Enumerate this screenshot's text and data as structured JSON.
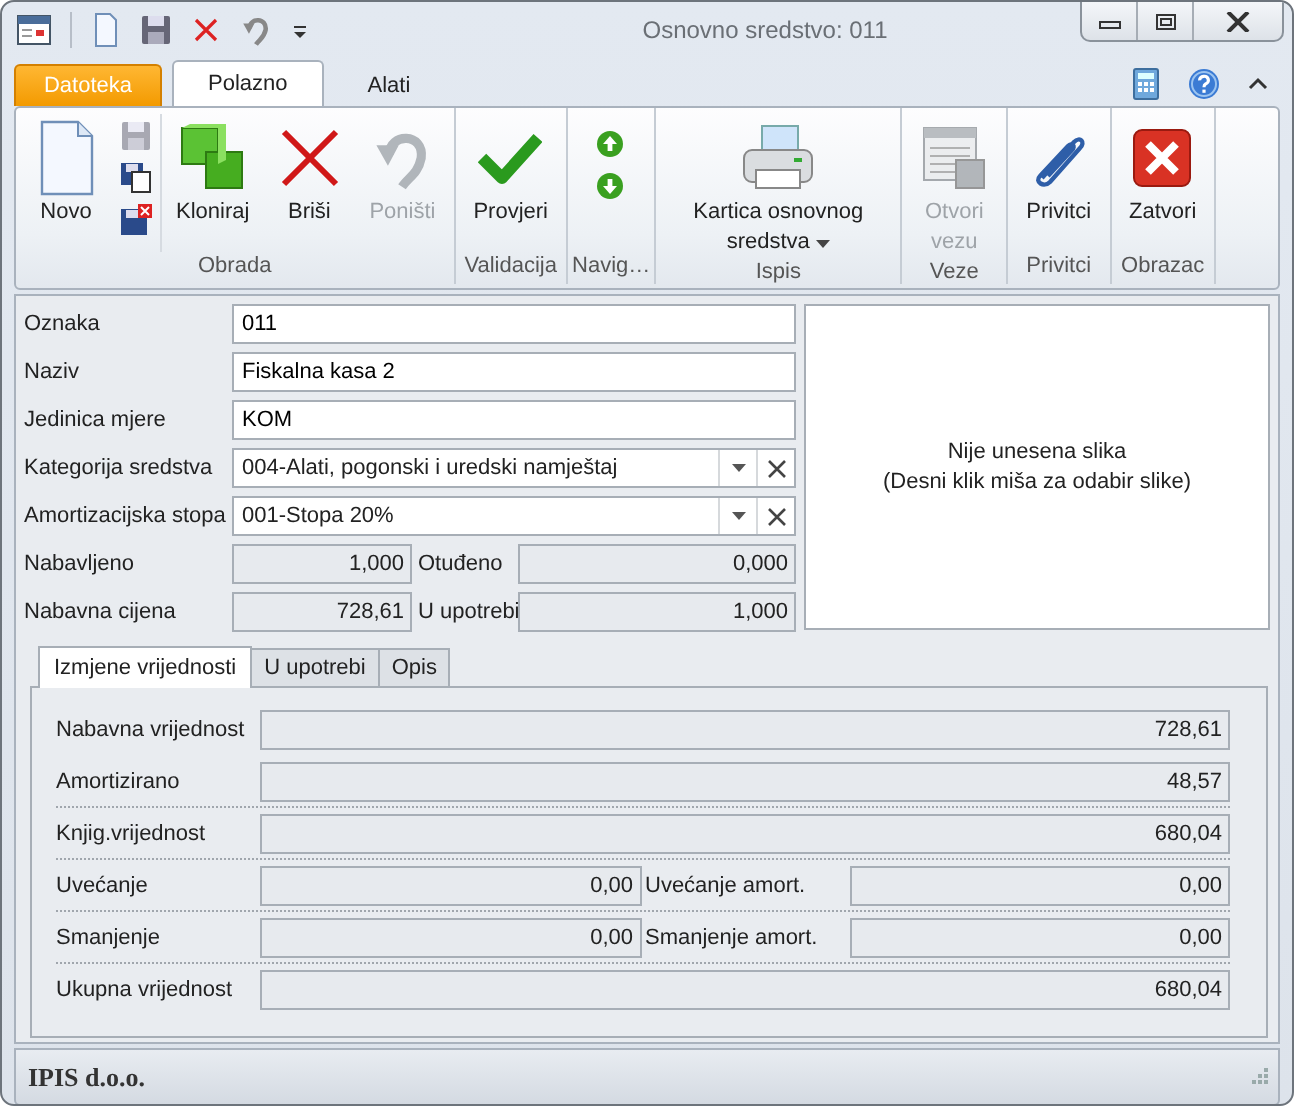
{
  "window": {
    "title": "Osnovno sredstvo: 011"
  },
  "ribbon_tabs": [
    {
      "label": "Datoteka",
      "kind": "file",
      "selected": false
    },
    {
      "label": "Polazno",
      "kind": "tab",
      "selected": true
    },
    {
      "label": "Alati",
      "kind": "tab",
      "selected": false
    }
  ],
  "ribbon_groups": [
    {
      "label": "Obrada",
      "buttons": [
        {
          "kind": "large",
          "label": "Novo",
          "disabled": false
        },
        {
          "kind": "stack"
        },
        {
          "kind": "large",
          "label": "Kloniraj",
          "disabled": false
        },
        {
          "kind": "large",
          "label": "Briši",
          "disabled": false
        },
        {
          "kind": "large",
          "label": "Poništi",
          "disabled": true
        }
      ]
    },
    {
      "label": "Validacija",
      "buttons": [
        {
          "kind": "large",
          "label": "Provjeri",
          "disabled": false
        }
      ]
    },
    {
      "label": "Navig…",
      "buttons": [
        {
          "kind": "updown"
        }
      ]
    },
    {
      "label": "Ispis",
      "buttons": [
        {
          "kind": "large",
          "label": "Kartica osnovnog sredstva",
          "disabled": false,
          "dropdown": true
        }
      ]
    },
    {
      "label": "Veze",
      "buttons": [
        {
          "kind": "large",
          "label": "Otvori vezu",
          "disabled": true
        }
      ]
    },
    {
      "label": "Privitci",
      "buttons": [
        {
          "kind": "large",
          "label": "Privitci",
          "disabled": false
        }
      ]
    },
    {
      "label": "Obrazac",
      "buttons": [
        {
          "kind": "large",
          "label": "Zatvori",
          "disabled": false
        }
      ]
    }
  ],
  "fields": [
    {
      "label": "Oznaka",
      "value": "011",
      "kind": "text"
    },
    {
      "label": "Naziv",
      "value": "Fiskalna kasa 2",
      "kind": "text"
    },
    {
      "label": "Jedinica mjere",
      "value": "KOM",
      "kind": "text"
    },
    {
      "label": "Kategorija sredstva",
      "value": "004-Alati, pogonski i uredski namještaj",
      "kind": "lookup"
    },
    {
      "label": "Amortizacijska stopa",
      "value": "001-Stopa 20%",
      "kind": "lookup"
    }
  ],
  "quantities": [
    [
      {
        "label": "Nabavljeno",
        "value": "1,000"
      },
      {
        "label": "Otuđeno",
        "value": "0,000"
      }
    ],
    [
      {
        "label": "Nabavna cijena",
        "value": "728,61"
      },
      {
        "label": "U upotrebi",
        "value": "1,000"
      }
    ]
  ],
  "image_panel": {
    "message": "Nije unesena slika",
    "hint": "(Desni klik miša za odabir slike)"
  },
  "detail_tabs": [
    {
      "label": "Izmjene vrijednosti",
      "selected": true
    },
    {
      "label": "U upotrebi",
      "selected": false
    },
    {
      "label": "Opis",
      "selected": false
    }
  ],
  "value_rows": [
    [
      {
        "label": "Nabavna vrijednost",
        "value": "728,61"
      }
    ],
    [
      {
        "label": "Amortizirano",
        "value": "48,57"
      }
    ],
    [
      {
        "label": "Knjig.vrijednost",
        "value": "680,04"
      }
    ],
    [
      {
        "label": "Uvećanje",
        "value": "0,00"
      },
      {
        "label": "Uvećanje amort.",
        "value": "0,00"
      }
    ],
    [
      {
        "label": "Smanjenje",
        "value": "0,00"
      },
      {
        "label": "Smanjenje amort.",
        "value": "0,00"
      }
    ],
    [
      {
        "label": "Ukupna vrijednost",
        "value": "680,04"
      }
    ]
  ],
  "status_bar": {
    "text": "IPIS d.o.o."
  }
}
